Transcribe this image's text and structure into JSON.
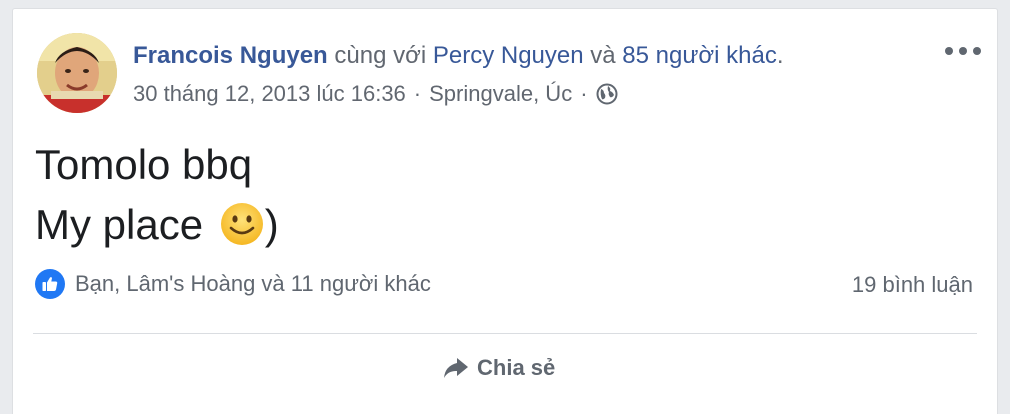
{
  "post": {
    "author": "Francois Nguyen",
    "with_text": "cùng với",
    "tagged_person": "Percy Nguyen",
    "and_text": "và",
    "others_link": "85 người khác",
    "period": ".",
    "date": "30 tháng 12, 2013 lúc 16:36",
    "separator": "·",
    "location": "Springvale, Úc",
    "separator2": "·",
    "privacy_icon": "globe-icon",
    "message_line1": "Tomolo bbq",
    "message_line2": "My place",
    "message_suffix": ")",
    "emoji": "slightly-smiling-face"
  },
  "reactions": {
    "icon": "like-icon",
    "text": "Bạn, Lâm's Hoàng và 11 người khác"
  },
  "comments": {
    "count_text": "19 bình luận"
  },
  "actions": {
    "share_label": "Chia sẻ"
  },
  "colors": {
    "link": "#385898",
    "like_blue": "#2078f4",
    "muted_text": "#606770"
  }
}
